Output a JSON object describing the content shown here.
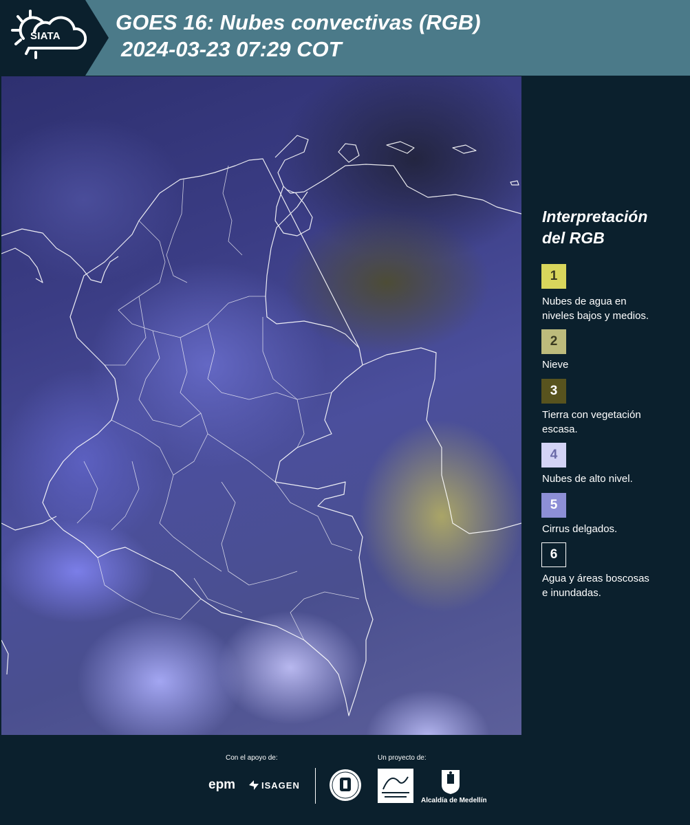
{
  "header": {
    "logo_text": "SIATA",
    "title_line1": "GOES 16: Nubes convectivas (RGB)",
    "title_line2": "2024-03-23 07:29 COT"
  },
  "legend": {
    "title_line1": "Interpretación",
    "title_line2": "del RGB",
    "items": [
      {
        "num": "1",
        "color": "#d9d65c",
        "text_color": "#3a3a20",
        "line1": "Nubes de agua en",
        "line2": "niveles bajos y medios."
      },
      {
        "num": "2",
        "color": "#bdbb7c",
        "text_color": "#3a3a20",
        "line1": "Nieve",
        "line2": ""
      },
      {
        "num": "3",
        "color": "#58531e",
        "text_color": "#ffffff",
        "line1": "Tierra con vegetación",
        "line2": "escasa."
      },
      {
        "num": "4",
        "color": "#d3d3f5",
        "text_color": "#6a6aa8",
        "line1": "Nubes de alto nivel.",
        "line2": ""
      },
      {
        "num": "5",
        "color": "#8d8fd6",
        "text_color": "#ffffff",
        "line1": "Cirrus delgados.",
        "line2": ""
      },
      {
        "num": "6",
        "color": "#0b202d",
        "text_color": "#ffffff",
        "line1": "Agua y áreas boscosas",
        "line2": "e inundadas."
      }
    ]
  },
  "footer": {
    "support_caption": "Con el apoyo de:",
    "project_caption": "Un proyecto de:",
    "sponsor_1": "epm",
    "sponsor_2": "ISAGEN",
    "partner_1_text": "Alcaldía de Medellín"
  },
  "colors": {
    "header_bg": "#4b7a89",
    "page_bg": "#0b202d",
    "border_line": "#ffffff"
  }
}
